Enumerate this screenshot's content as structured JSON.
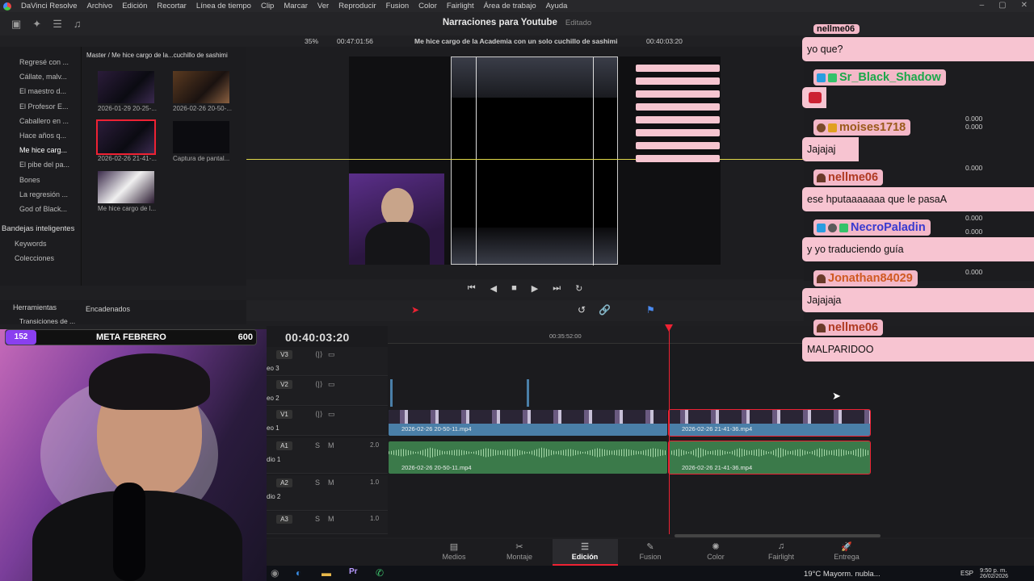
{
  "app": {
    "name": "DaVinci Resolve"
  },
  "menu": [
    "Archivo",
    "Edición",
    "Recortar",
    "Línea de tiempo",
    "Clip",
    "Marcar",
    "Ver",
    "Reproducir",
    "Fusion",
    "Color",
    "Fairlight",
    "Área de trabajo",
    "Ayuda"
  ],
  "project": {
    "title": "Narraciones para Youtube",
    "status": "Editado"
  },
  "viewer_bar": {
    "zoom": "35%",
    "timecode_left": "00:47:01:56",
    "clip_title": "Me hice cargo de la Academia con un solo cuchillo de sashimi",
    "timecode_right": "00:40:03:20"
  },
  "breadcrumb": "Master / Me hice cargo de la...cuchillo de sashimi",
  "bins": [
    "Regresé con ...",
    "Cállate, malv...",
    "El maestro d...",
    "El Profesor E...",
    "Caballero en ...",
    "Hace años q...",
    "Me hice carg...",
    "El pibe del pa...",
    "Bones",
    "La regresión ...",
    "God of Black..."
  ],
  "bins_selected_index": 6,
  "smart_bins": {
    "title": "Bandejas inteligentes",
    "items": [
      "Keywords",
      "Colecciones"
    ]
  },
  "media_items": [
    {
      "label": "2026-01-29 20-25-..."
    },
    {
      "label": "2026-02-26 20-50-..."
    },
    {
      "label": "2026-02-26 21-41-..."
    },
    {
      "label": "Captura de pantal..."
    },
    {
      "label": "Me hice cargo de l..."
    }
  ],
  "tools_panel": {
    "title": "Herramientas",
    "section": "Encadenados",
    "sub": "Transiciones de ..."
  },
  "timeline": {
    "timecode": "00:40:03:20",
    "ruler_label": "00:35:52:00",
    "tracks": [
      {
        "id": "V3",
        "name": "eo 3"
      },
      {
        "id": "V2",
        "name": "eo 2"
      },
      {
        "id": "V1",
        "name": "eo 1"
      },
      {
        "id": "A1",
        "name": "dio 1",
        "vol": "2.0"
      },
      {
        "id": "A2",
        "name": "dio 2",
        "vol": "1.0"
      },
      {
        "id": "A3",
        "name": "",
        "vol": "1.0"
      }
    ],
    "clips": {
      "v1_left": "2026-02-26 20-50-11.mp4",
      "v1_right": "2026-02-26 21-41-36.mp4",
      "a1_left": "2026-02-26 20-50-11.mp4",
      "a1_right": "2026-02-26 21-41-36.mp4"
    }
  },
  "pages": [
    {
      "label": "Medios",
      "icon": "media-icon"
    },
    {
      "label": "Montaje",
      "icon": "cut-icon"
    },
    {
      "label": "Edición",
      "icon": "edit-icon",
      "active": true
    },
    {
      "label": "Fusion",
      "icon": "fusion-icon"
    },
    {
      "label": "Color",
      "icon": "color-icon"
    },
    {
      "label": "Fairlight",
      "icon": "fairlight-icon"
    },
    {
      "label": "Entrega",
      "icon": "deliver-icon"
    }
  ],
  "overlay": {
    "goal": {
      "count": "152",
      "title": "META FEBRERO",
      "target": "600"
    },
    "chat": [
      {
        "user": "nellme06",
        "text": "yo que?"
      },
      {
        "user": "Sr_Black_Shadow",
        "text": ""
      },
      {
        "user": "moises1718",
        "text": "Jajajaj"
      },
      {
        "user": "nellme06",
        "text": "ese hputaaaaaaa que le pasaA"
      },
      {
        "user": "NecroPaladin",
        "text": "y yo traduciendo guía"
      },
      {
        "user": "Jonathan84029",
        "text": "Jajajaja"
      },
      {
        "user": "nellme06",
        "text": "MALPARIDOO"
      }
    ]
  },
  "inspector_values": [
    "0.000",
    "0.000",
    "0.000",
    "0.000",
    "0.000",
    "0.000"
  ],
  "taskbar": {
    "weather": "19°C  Mayorm. nubla...",
    "lang": "ESP",
    "time": "9:50 p. m.",
    "date": "26/02/2026"
  },
  "colors": {
    "accent_red": "#e22233",
    "chat_bg": "#f7c4d1",
    "goal_purple": "#8a3ff0",
    "video_clip": "#4a7fa8",
    "audio_clip": "#3b7a4a"
  }
}
